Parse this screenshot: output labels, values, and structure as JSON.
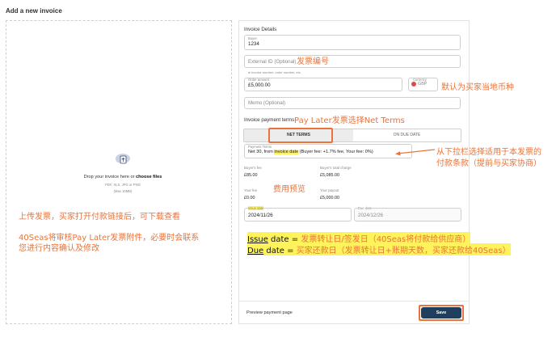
{
  "page": {
    "title": "Add a new invoice"
  },
  "upload": {
    "text_prefix": "Drop your invoice here or ",
    "text_link": "choose files",
    "formats": "PDF, XLS, JPG or PNG",
    "max": "(Max 10MB)"
  },
  "invoice_details": {
    "section_title": "Invoice Details",
    "buyer": {
      "label": "Buyer",
      "value": "1234"
    },
    "external_id": {
      "placeholder": "External ID (Optional)",
      "hint": "ie invoice number, order number, etc."
    },
    "order_amount": {
      "label": "Order amount",
      "value": "£5,000.00"
    },
    "currency": {
      "label": "Currency",
      "value": "GBP"
    },
    "memo": {
      "placeholder": "Memo (Optional)"
    }
  },
  "payment_terms": {
    "section_title": "Invoice payment terms",
    "tabs": [
      {
        "label": "NET TERMS"
      },
      {
        "label": "ON DUE DATE"
      }
    ],
    "select": {
      "label": "Payment Terms",
      "value_prefix": "Net 30, from ",
      "value_highlight": "invoice date",
      "value_suffix": " (Buyer fee: +1.7% fee, Your fee: 0%)"
    },
    "fees": {
      "buyer_fee": {
        "label": "Buyer's fee",
        "value": "£85.00"
      },
      "buyer_total": {
        "label": "Buyer's total charge",
        "value": "£5,085.00"
      },
      "your_fee": {
        "label": "Your fee",
        "value": "£0.00"
      },
      "your_payout": {
        "label": "Your payout",
        "value": "£5,000.00"
      }
    },
    "issue_date": {
      "label": "Issue date",
      "value": "2024/11/26"
    },
    "due_date": {
      "label": "Due date",
      "value": "2024/12/26"
    }
  },
  "footer": {
    "preview_link": "Preview payment page",
    "save": "Save"
  },
  "annotations": {
    "external_id": "发票编号",
    "currency": "默认为买家当地币种",
    "payment_terms": "Pay Later发票选择Net Terms",
    "dropdown_1": "从下拉栏选择适用于本发票的",
    "dropdown_2": "付款条款（提前与买家协商）",
    "fees": "费用预览",
    "upload_1": "上传发票，买家打开付款链接后，可下载查看",
    "upload_2": "40Seas将审核Pay Later发票附件，必要时会联系",
    "upload_3": "您进行内容确认及修改",
    "issue_date_key": "Issue",
    "issue_date_rest": " date = ",
    "issue_date_desc": "发票转让日/签发日（40Seas将付款给供应商）",
    "due_date_key": "Due",
    "due_date_rest": " date = ",
    "due_date_desc": "买家还款日（发票转让日+账期天数，买家还款给40Seas）"
  },
  "colors": {
    "accent": "#e8743b",
    "primary_button": "#1f3f5c",
    "highlight": "#fff35c"
  }
}
